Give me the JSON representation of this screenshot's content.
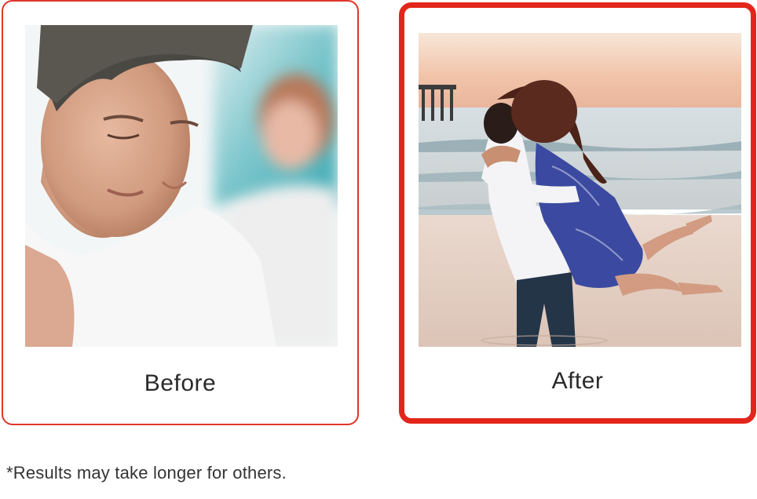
{
  "before_card": {
    "caption": "Before",
    "image": "sad-man-woman-blurred-photo",
    "border_color": "#e0352b"
  },
  "after_card": {
    "caption": "After",
    "image": "couple-hugging-on-beach-photo",
    "border_color": "#e3261b"
  },
  "footnote": "*Results may take longer for others."
}
